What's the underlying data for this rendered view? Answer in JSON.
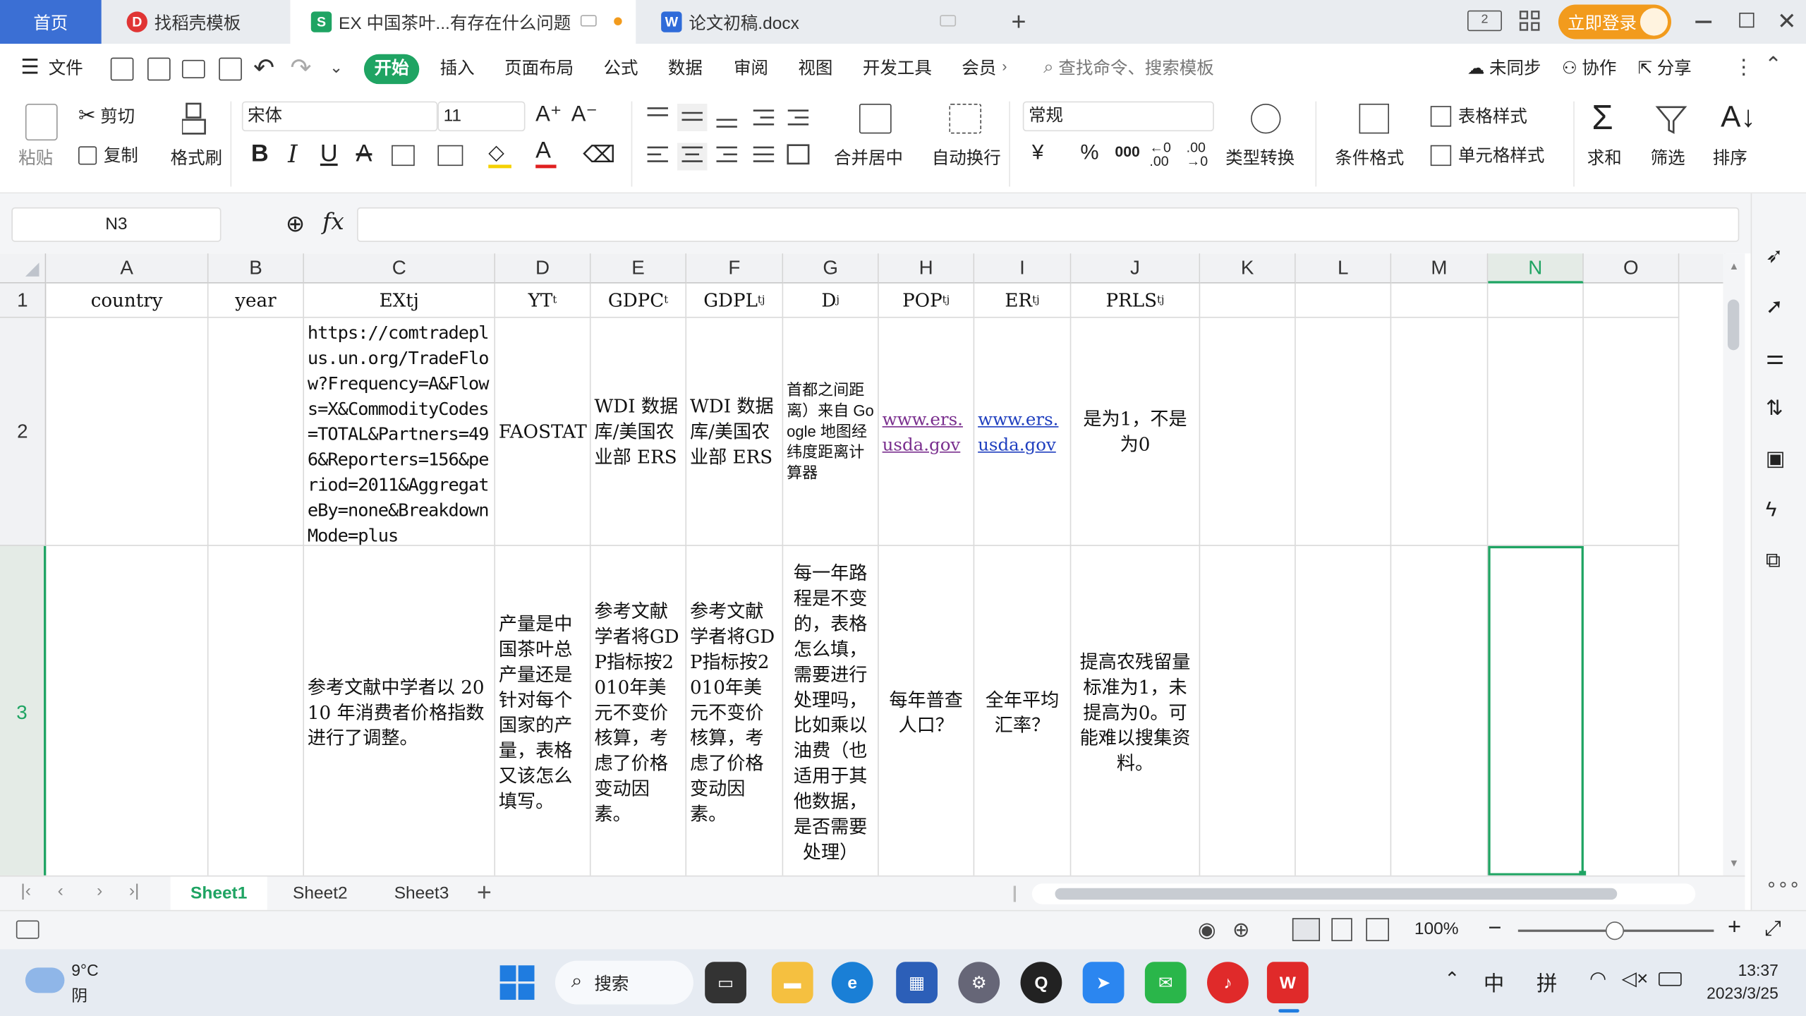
{
  "tabs": {
    "home": "首页",
    "find_template": "找稻壳模板",
    "excel_tab": "EX 中国茶叶...有存在什么问题",
    "word_tab": "论文初稿.docx",
    "login": "立即登录"
  },
  "menu": {
    "file": "文件",
    "start": "开始",
    "insert": "插入",
    "page_layout": "页面布局",
    "formula": "公式",
    "data": "数据",
    "review": "审阅",
    "view": "视图",
    "dev": "开发工具",
    "member": "会员",
    "search_placeholder": "查找命令、搜索模板",
    "sync": "未同步",
    "collab": "协作",
    "share": "分享"
  },
  "ribbon": {
    "paste": "粘贴",
    "cut": "剪切",
    "copy": "复制",
    "format_painter": "格式刷",
    "font": "宋体",
    "font_size": "11",
    "merge": "合并居中",
    "wrap": "自动换行",
    "number_format": "常规",
    "type_convert": "类型转换",
    "cond_format": "条件格式",
    "table_style": "表格样式",
    "cell_style": "单元格样式",
    "sum": "求和",
    "filter": "筛选",
    "sort": "排序",
    "currency": "¥",
    "percent": "%",
    "thousands": "000"
  },
  "formula_bar": {
    "name_box": "N3",
    "fx": "fx",
    "value": ""
  },
  "columns": [
    "A",
    "B",
    "C",
    "D",
    "E",
    "F",
    "G",
    "H",
    "I",
    "J",
    "K",
    "L",
    "M",
    "N",
    "O"
  ],
  "rows": [
    "1",
    "2",
    "3"
  ],
  "headers": {
    "A": "country",
    "B": "year",
    "C": "EXtj",
    "D": "YT",
    "D_sub": "t",
    "E": "GDPC",
    "E_sub": "t",
    "F": "GDPL",
    "F_sub": "tj",
    "G": "D",
    "G_sub": "j",
    "H": "POP",
    "H_sub": "tj",
    "I": "ER",
    "I_sub": "tj",
    "J": "PRLS",
    "J_sub": "tj"
  },
  "row2": {
    "C": "https://comtradeplus.un.org/TradeFlow?Frequency=A&Flows=X&CommodityCodes=TOTAL&Partners=496&Reporters=156&period=2011&AggregateBy=none&BreakdownMode=plus",
    "D": "FAOSTAT",
    "E": "WDI 数据库/美国农业部 ERS",
    "F": "WDI 数据库/美国农业部 ERS",
    "G": "首都之间距离）来自 Google 地图经纬度距离计算器",
    "H": "www.ers.usda.gov",
    "I": "www.ers.usda.gov",
    "J": "是为1，不是为0"
  },
  "row3": {
    "C": "参考文献中学者以 2010 年消费者价格指数进行了调整。",
    "D": "产量是中国茶叶总产量还是针对每个国家的产量，表格又该怎么填写。",
    "E": "参考文献学者将GDP指标按2010年美元不变价核算，考虑了价格变动因素。",
    "F": "参考文献学者将GDP指标按2010年美元不变价核算，考虑了价格变动因素。",
    "G": "每一年路程是不变的，表格怎么填，需要进行处理吗，比如乘以油费（也适用于其他数据，是否需要处理）",
    "H": "每年普查人口？",
    "I": "全年平均汇率？",
    "J": "提高农残留量标准为1，未提高为0。可能难以搜集资料。"
  },
  "sheets": [
    "Sheet1",
    "Sheet2",
    "Sheet3"
  ],
  "status": {
    "zoom": "100%"
  },
  "taskbar": {
    "temp": "9°C",
    "weather": "阴",
    "search": "搜索",
    "ime_lang": "中",
    "ime_mode": "拼",
    "time": "13:37",
    "date": "2023/3/25"
  },
  "colors": {
    "accent": "#1fa463",
    "home_tab": "#3b6fd4",
    "login": "#f29b1d"
  }
}
